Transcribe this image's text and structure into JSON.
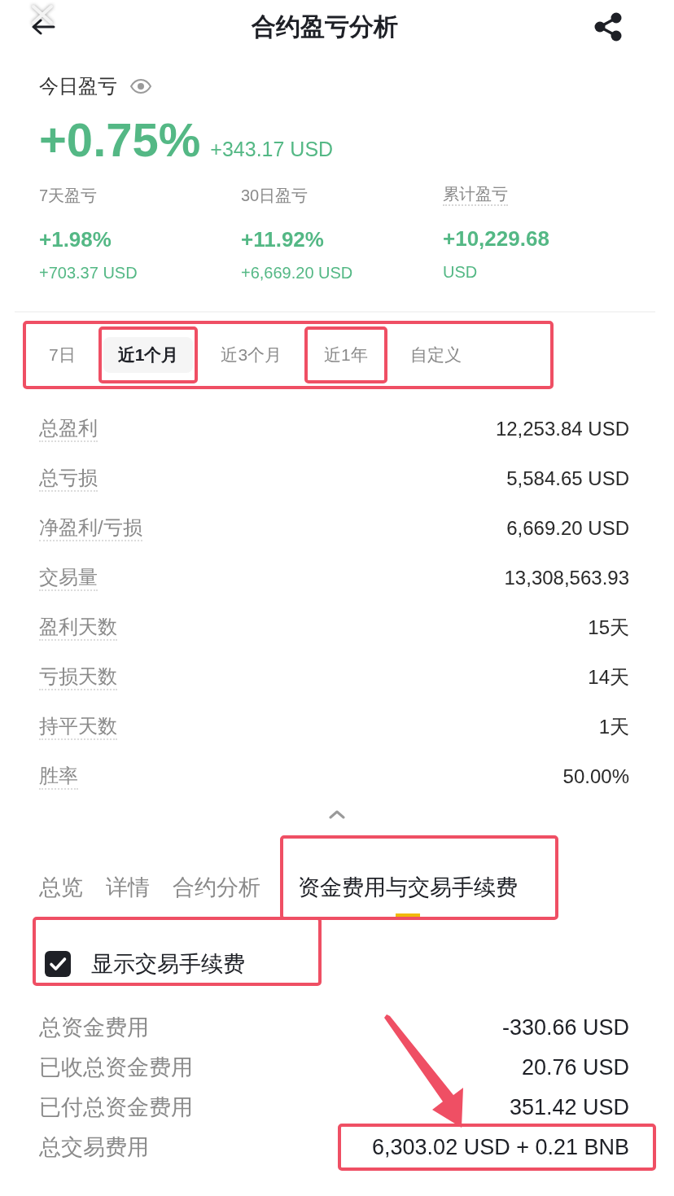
{
  "header": {
    "title": "合约盈亏分析"
  },
  "today": {
    "label": "今日盈亏",
    "percent": "+0.75%",
    "amount": "+343.17 USD"
  },
  "summary": [
    {
      "label": "7天盈亏",
      "tooltip": false,
      "value": "+1.98%",
      "sub": "+703.37 USD"
    },
    {
      "label": "30日盈亏",
      "tooltip": false,
      "value": "+11.92%",
      "sub": "+6,669.20 USD"
    },
    {
      "label": "累计盈亏",
      "tooltip": true,
      "value": "+10,229.68",
      "sub": "USD"
    }
  ],
  "period_filter": {
    "highlighted": true,
    "options": [
      {
        "label": "7日",
        "selected": false,
        "highlighted": false
      },
      {
        "label": "近1个月",
        "selected": true,
        "highlighted": true
      },
      {
        "label": "近3个月",
        "selected": false,
        "highlighted": false
      },
      {
        "label": "近1年",
        "selected": false,
        "highlighted": true
      },
      {
        "label": "自定义",
        "selected": false,
        "highlighted": false
      }
    ]
  },
  "stats": [
    {
      "label": "总盈利",
      "value": "12,253.84 USD"
    },
    {
      "label": "总亏损",
      "value": "5,584.65 USD"
    },
    {
      "label": "净盈利/亏损",
      "value": "6,669.20 USD"
    },
    {
      "label": "交易量",
      "value": "13,308,563.93"
    },
    {
      "label": "盈利天数",
      "value": "15天"
    },
    {
      "label": "亏损天数",
      "value": "14天"
    },
    {
      "label": "持平天数",
      "value": "1天"
    },
    {
      "label": "胜率",
      "value": "50.00%"
    }
  ],
  "section_tabs": [
    {
      "label": "总览",
      "selected": false,
      "highlighted": false
    },
    {
      "label": "详情",
      "selected": false,
      "highlighted": false
    },
    {
      "label": "合约分析",
      "selected": false,
      "highlighted": false
    },
    {
      "label": "资金费用与交易手续费",
      "selected": true,
      "highlighted": true
    }
  ],
  "fee_toggle": {
    "label": "显示交易手续费",
    "checked": true,
    "highlighted": true
  },
  "fees": [
    {
      "label": "总资金费用",
      "value": "-330.66 USD",
      "highlighted": false
    },
    {
      "label": "已收总资金费用",
      "value": "20.76 USD",
      "highlighted": false
    },
    {
      "label": "已付总资金费用",
      "value": "351.42 USD",
      "highlighted": false
    },
    {
      "label": "总交易费用",
      "value": "6,303.02 USD + 0.21 BNB",
      "highlighted": true
    }
  ],
  "annotation_arrow": true
}
